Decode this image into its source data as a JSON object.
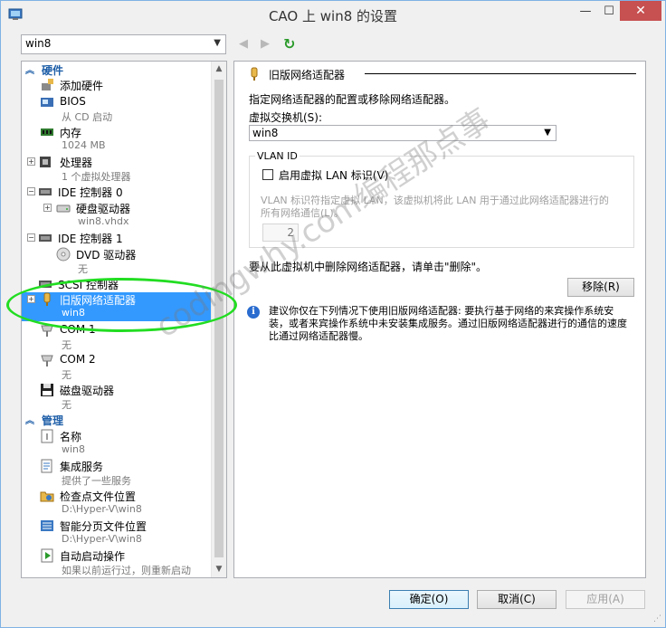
{
  "window": {
    "title": "CAO 上 win8 的设置",
    "close_glyph": "✕",
    "min_glyph": "—",
    "max_glyph": "☐"
  },
  "vm_selector": {
    "value": "win8"
  },
  "tree": {
    "hardware_header": "硬件",
    "management_header": "管理",
    "items": [
      {
        "name": "添加硬件",
        "sub": ""
      },
      {
        "name": "BIOS",
        "sub": "从 CD 启动"
      },
      {
        "name": "内存",
        "sub": "1024 MB"
      },
      {
        "name": "处理器",
        "sub": "1 个虚拟处理器"
      },
      {
        "name": "IDE 控制器 0",
        "sub": ""
      },
      {
        "name": "硬盘驱动器",
        "sub": "win8.vhdx"
      },
      {
        "name": "IDE 控制器 1",
        "sub": ""
      },
      {
        "name": "DVD 驱动器",
        "sub": "无"
      },
      {
        "name": "SCSI 控制器",
        "sub": ""
      },
      {
        "name": "旧版网络适配器",
        "sub": "win8"
      },
      {
        "name": "COM 1",
        "sub": "无"
      },
      {
        "name": "COM 2",
        "sub": "无"
      },
      {
        "name": "磁盘驱动器",
        "sub": "无"
      }
    ],
    "mgmt_items": [
      {
        "name": "名称",
        "sub": "win8"
      },
      {
        "name": "集成服务",
        "sub": "提供了一些服务"
      },
      {
        "name": "检查点文件位置",
        "sub": "D:\\Hyper-V\\win8"
      },
      {
        "name": "智能分页文件位置",
        "sub": "D:\\Hyper-V\\win8"
      },
      {
        "name": "自动启动操作",
        "sub": "如果以前运行过，则重新启动"
      }
    ]
  },
  "detail": {
    "section_title": "旧版网络适配器",
    "description": "指定网络适配器的配置或移除网络适配器。",
    "switch_label": "虚拟交换机(S):",
    "switch_value": "win8",
    "vlan_legend": "VLAN ID",
    "vlan_checkbox": "启用虚拟 LAN 标识(V)",
    "vlan_desc_1": "VLAN 标识符指定虚拟 LAN，该虚拟机将此 LAN 用于通过此网络适配器进行的",
    "vlan_desc_2": "所有网络通信(L)。",
    "vlan_value": "2",
    "remove_hint": "要从此虚拟机中删除网络适配器，请单击\"删除\"。",
    "remove_button": "移除(R)",
    "info": "建议你仅在下列情况下使用旧版网络适配器: 要执行基于网络的来宾操作系统安装，或者来宾操作系统中未安装集成服务。通过旧版网络适配器进行的通信的速度比通过网络适配器慢。"
  },
  "footer": {
    "ok": "确定(O)",
    "cancel": "取消(C)",
    "apply": "应用(A)"
  },
  "watermark": "codingwhy.com编程那点事",
  "colors": {
    "selection": "#3399ff",
    "header_text": "#1f5fa8",
    "highlight_ring": "#22dd22",
    "close_button": "#c75050"
  }
}
